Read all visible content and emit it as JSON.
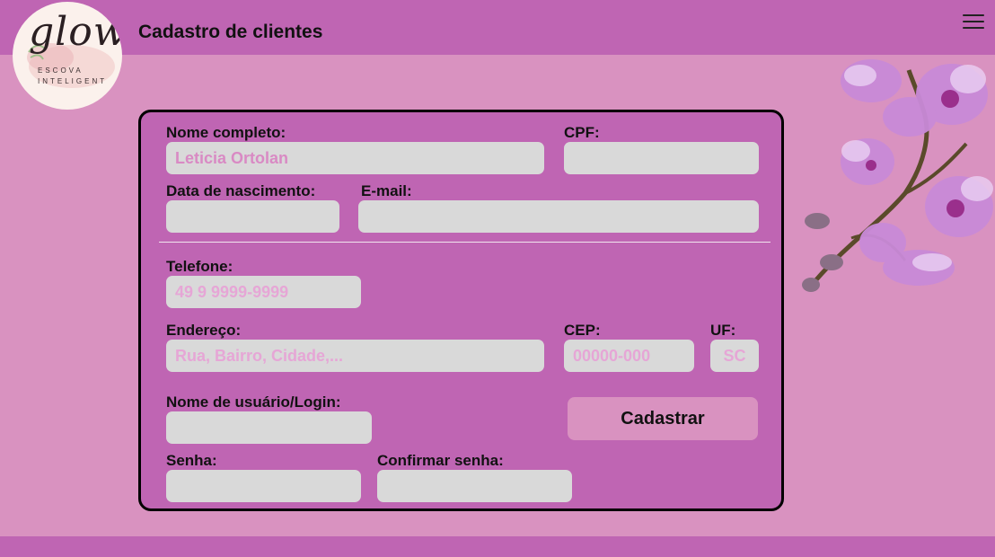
{
  "header": {
    "title": "Cadastro de clientes",
    "menu_icon": "hamburger-menu-icon"
  },
  "logo": {
    "word": "glow",
    "line1": "ESCOVA",
    "line2": "INTELIGENT"
  },
  "decoration": {
    "image": "orchid-flower-illustration"
  },
  "form": {
    "name_label": "Nome completo:",
    "name_value": "Leticia Ortolan",
    "cpf_label": "CPF:",
    "birth_label": "Data de nascimento:",
    "email_label": "E-mail:",
    "phone_label": "Telefone:",
    "phone_placeholder": "49 9 9999-9999",
    "address_label": "Endereço:",
    "address_placeholder": "Rua, Bairro, Cidade,...",
    "cep_label": "CEP:",
    "cep_placeholder": "00000-000",
    "uf_label": "UF:",
    "uf_placeholder": "SC",
    "username_label": "Nome de usuário/Login:",
    "password_label": "Senha:",
    "confirm_password_label": "Confirmar senha:",
    "submit_label": "Cadastrar"
  },
  "colors": {
    "background": "#d992c0",
    "bar": "#bf65b3",
    "panel": "#bf65b3",
    "field": "#d9d9d9",
    "placeholder": "#e6a6d6",
    "button": "#d992c0"
  }
}
